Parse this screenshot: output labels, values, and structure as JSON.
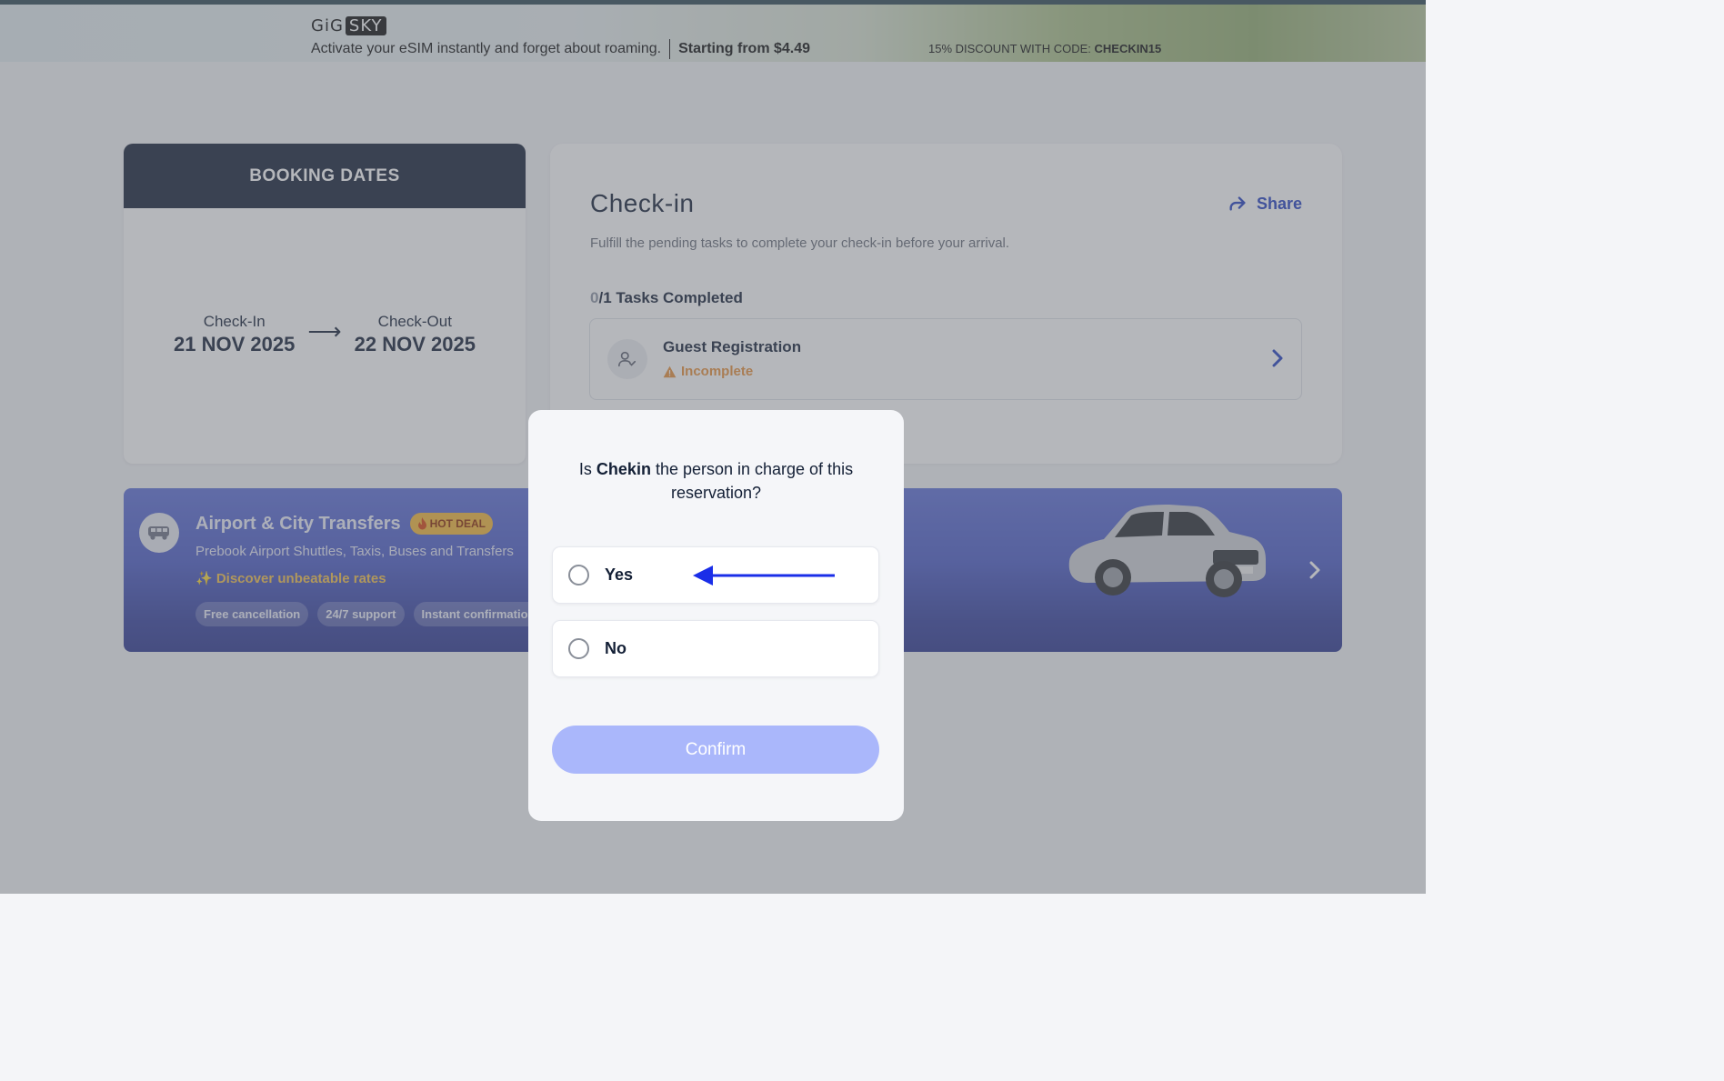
{
  "promo": {
    "logo_gig": "GiG",
    "logo_sky": "SKY",
    "tagline": "Activate your eSIM instantly and forget about roaming.",
    "price": "Starting from $4.49",
    "discount_label": "15% DISCOUNT WITH CODE:",
    "discount_code": "CHECKIN15"
  },
  "booking": {
    "header": "BOOKING DATES",
    "checkin_label": "Check-In",
    "checkin_date": "21 NOV 2025",
    "arrow": "⟶",
    "checkout_label": "Check-Out",
    "checkout_date": "22 NOV 2025"
  },
  "checkin": {
    "title": "Check-in",
    "share_label": "Share",
    "subtitle": "Fulfill the pending tasks to complete your check-in before your arrival.",
    "tasks_done": "0",
    "tasks_rest": "/1 Tasks Completed",
    "task": {
      "name": "Guest Registration",
      "status": "Incomplete",
      "status_color": "#e8913a"
    }
  },
  "transfer": {
    "title": "Airport & City Transfers",
    "badge": "HOT DEAL",
    "subtitle": "Prebook Airport Shuttles, Taxis, Buses and Transfers",
    "rates": "✨ Discover unbeatable rates",
    "chips": [
      "Free cancellation",
      "24/7 support",
      "Instant confirmation"
    ]
  },
  "modal": {
    "question_prefix": "Is ",
    "question_name": "Chekin",
    "question_suffix": " the person in charge of this reservation?",
    "options": [
      {
        "label": "Yes",
        "selected": false
      },
      {
        "label": "No",
        "selected": false
      }
    ],
    "confirm_label": "Confirm",
    "confirm_color": "#aab7fb",
    "accent_color": "#1a2ee8"
  }
}
